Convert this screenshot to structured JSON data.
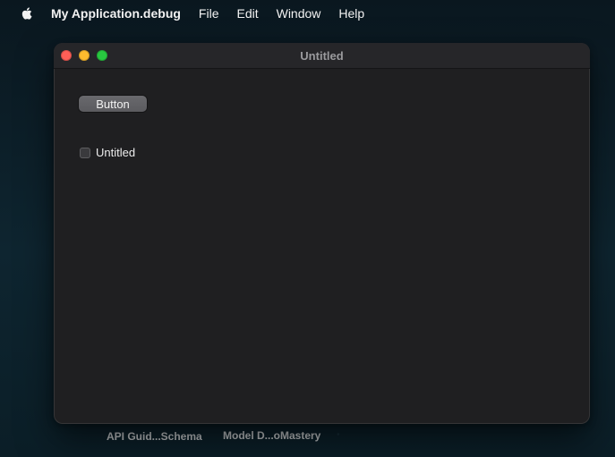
{
  "menubar": {
    "apple_icon": "apple-logo-icon",
    "app_name": "My Application.debug",
    "items": [
      "File",
      "Edit",
      "Window",
      "Help"
    ]
  },
  "desktop": {
    "labels": [
      {
        "text": "API Guid...Schema"
      },
      {
        "text": "Model D...oMastery"
      }
    ]
  },
  "window": {
    "title": "Untitled",
    "button_label": "Button",
    "checkbox_label": "Untitled",
    "checkbox_checked": false,
    "controls": [
      "close-icon",
      "minimize-icon",
      "zoom-icon"
    ]
  },
  "colors": {
    "close": "#ff5f57",
    "minimize": "#febc2e",
    "zoom": "#28c840",
    "window_bg": "#1f1f21"
  }
}
